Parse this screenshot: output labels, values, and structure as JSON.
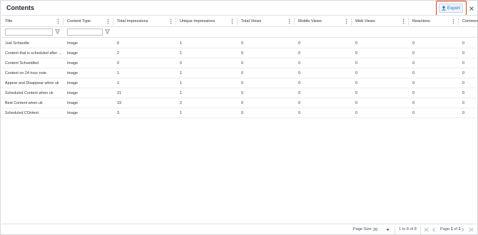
{
  "header": {
    "title": "Contents",
    "export_label": "Export"
  },
  "columns": [
    {
      "label": "Title",
      "has_filter": true
    },
    {
      "label": "Content Type",
      "has_filter": true
    },
    {
      "label": "Total Impressions",
      "has_filter": false
    },
    {
      "label": "Unique Impressions",
      "has_filter": false
    },
    {
      "label": "Total Views",
      "has_filter": false
    },
    {
      "label": "Mobile Views",
      "has_filter": false
    },
    {
      "label": "Web Views",
      "has_filter": false
    },
    {
      "label": "Reactions",
      "has_filter": false
    },
    {
      "label": "Comments",
      "has_filter": false
    }
  ],
  "filters": {
    "title_value": "",
    "content_type_value": ""
  },
  "rows": [
    [
      "Just Schaudle",
      "Image",
      "6",
      "1",
      "0",
      "0",
      "0",
      "0",
      "0"
    ],
    [
      "Content that is scheduled after 5 ...",
      "Image",
      "2",
      "1",
      "0",
      "0",
      "0",
      "0",
      "0"
    ],
    [
      "Content Schueldled",
      "Image",
      "0",
      "0",
      "0",
      "0",
      "0",
      "0",
      "0"
    ],
    [
      "Content on 24 hour note",
      "Image",
      "1",
      "1",
      "0",
      "0",
      "0",
      "0",
      "0"
    ],
    [
      "Appear and Disappear whne uk",
      "Image",
      "1",
      "1",
      "0",
      "0",
      "0",
      "0",
      "0"
    ],
    [
      "Scheduled Content when uk",
      "Image",
      "21",
      "1",
      "0",
      "0",
      "0",
      "0",
      "0"
    ],
    [
      "Best Content when uk",
      "Image",
      "19",
      "2",
      "0",
      "0",
      "0",
      "0",
      "0"
    ],
    [
      "Scheduled COntent",
      "Image",
      "3",
      "1",
      "0",
      "0",
      "0",
      "0",
      "0"
    ]
  ],
  "footer": {
    "page_size_label": "Page Size:",
    "page_size_value": "20",
    "range_text": "1 to 8 of 8",
    "page_text_prefix": "Page ",
    "page_current": "1",
    "page_text_of": " of ",
    "page_total": "1"
  },
  "colors": {
    "accent": "#1a6bc2",
    "highlight_border": "#d9411e",
    "grid_line": "#dde1e5"
  },
  "icons": {
    "export": "upload-icon",
    "close": "close-icon",
    "filter": "filter-icon",
    "column_menu": "kebab-menu-icon"
  }
}
